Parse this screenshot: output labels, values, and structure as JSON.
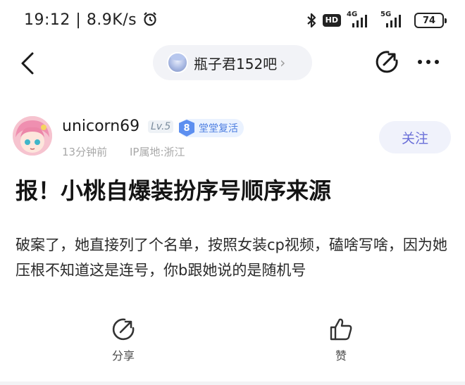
{
  "status_bar": {
    "time": "19:12",
    "speed": "8.9K/s",
    "hd_label": "HD",
    "network_1": "4G",
    "network_2": "5G",
    "battery": "74"
  },
  "nav": {
    "forum_name": "瓶子君152吧",
    "forum_chevron": "›"
  },
  "author": {
    "name": "unicorn69",
    "level": "Lv.5",
    "honor_number": "8",
    "honor_title": "堂堂复活",
    "time_ago": "13分钟前",
    "ip_location": "IP属地:浙江",
    "follow_label": "关注"
  },
  "post": {
    "title": "报！小桃自爆装扮序号顺序来源",
    "body": "破案了，她直接列了个名单，按照女装cp视频，磕啥写啥，因为她压根不知道这是连号，你b跟她说的是随机号"
  },
  "actions": {
    "share_label": "分享",
    "like_label": "赞"
  },
  "icons": [
    "back-icon",
    "share-icon",
    "more-icon",
    "bluetooth-icon",
    "alarm-icon",
    "like-icon"
  ],
  "colors": {
    "follow_text": "#6a6fd8",
    "follow_bg": "#f0f2fb",
    "honor_blue": "#5d8ff0",
    "pill_bg": "#f2f3f7"
  }
}
